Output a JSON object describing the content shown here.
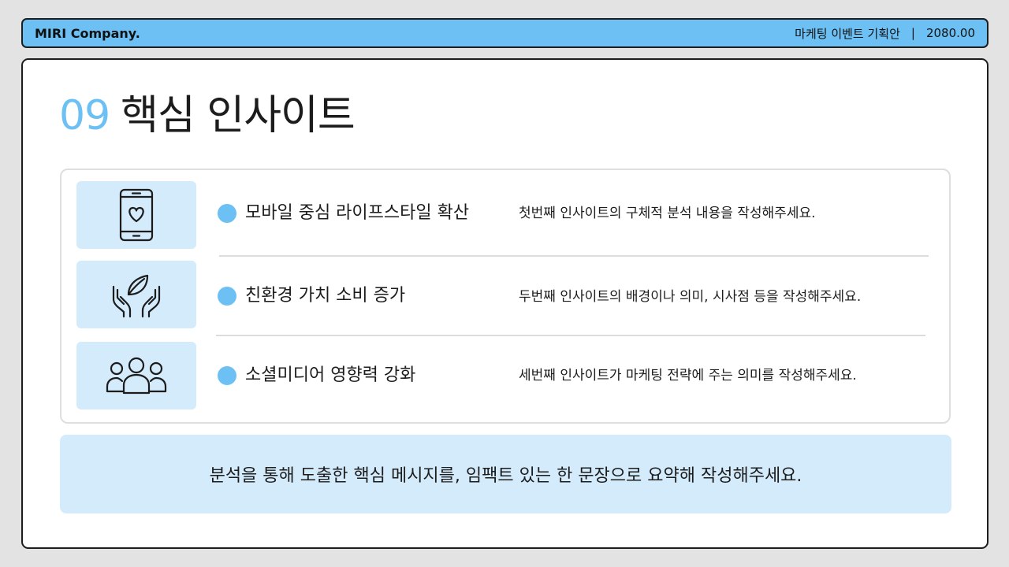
{
  "header": {
    "brand": "MIRI Company.",
    "doc_title": "마케팅 이벤트 기획안",
    "separator": "|",
    "number": "2080.00"
  },
  "page": {
    "number": "09",
    "title": "핵심 인사이트"
  },
  "insights": [
    {
      "icon": "smartphone-heart-icon",
      "title": "모바일 중심 라이프스타일 확산",
      "desc": "첫번째 인사이트의 구체적 분석 내용을 작성해주세요."
    },
    {
      "icon": "hands-leaf-icon",
      "title": "친환경 가치 소비 증가",
      "desc": "두번째 인사이트의 배경이나 의미, 시사점 등을 작성해주세요."
    },
    {
      "icon": "people-group-icon",
      "title": "소셜미디어 영향력 강화",
      "desc": "세번째 인사이트가 마케팅 전략에 주는 의미를 작성해주세요."
    }
  ],
  "summary": "분석을 통해 도출한 핵심 메시지를, 임팩트 있는 한 문장으로 요약해 작성해주세요.",
  "colors": {
    "accent": "#6cc0f3",
    "tile": "#d4ebfc",
    "border": "#1d1d1d"
  }
}
